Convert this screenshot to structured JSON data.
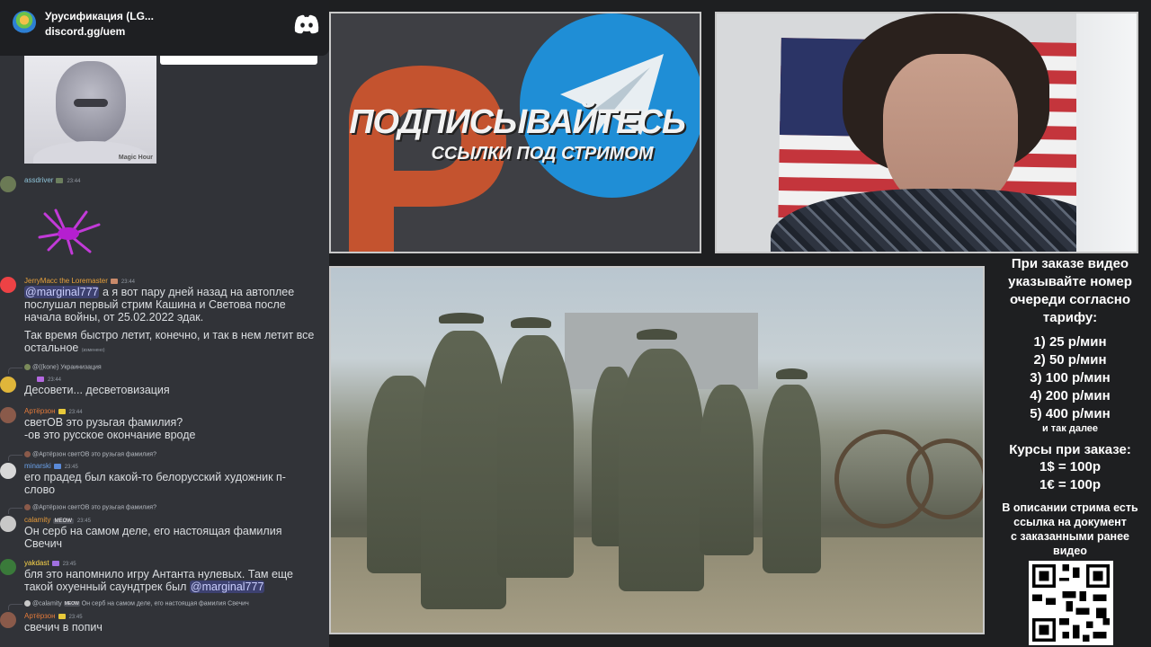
{
  "server": {
    "name": "Урусификация (LG...",
    "invite": "discord.gg/uem"
  },
  "meme": {
    "watermark": "Magic Hour"
  },
  "messages": [
    {
      "user": "assdriver",
      "time": "23:44"
    },
    {
      "user": "JerryMacc the Loremaster",
      "time": "23:44",
      "mention": "@marginal777",
      "line1": " а я вот пару дней назад на автоплее",
      "line2": "послушал первый стрим Кашина и Светова после",
      "line3": "начала войны, от 25.02.2022 эдак.",
      "line4": "Так время быстро летит, конечно, и так в нем летит все",
      "line5": "остальное",
      "edited": "(изменено)"
    },
    {
      "reply_user": "@((kone)",
      "reply_text": "Украинизация",
      "time": "23:44",
      "text": "Десовети... десветовизация"
    },
    {
      "user": "Артёрзон",
      "time": "23:44",
      "line1": "светОВ это рузьгая фамилия?",
      "line2": "-ов это русское окончание вроде"
    },
    {
      "reply_user": "@Артёрзон",
      "reply_text": "светОВ это рузьгая фамилия?",
      "user": "minarski",
      "time": "23:45",
      "line1": "его прадед был какой-то белорусский художник п-",
      "line2": "слово"
    },
    {
      "reply_user": "@Артёрзон",
      "reply_text": "светОВ это рузьгая фамилия?",
      "user": "calamity",
      "tag": "MEOW",
      "time": "23:45",
      "line1": "Он серб на самом деле, его настоящая фамилия",
      "line2": "Свечич"
    },
    {
      "user": "yakdast",
      "time": "23:45",
      "line1": "бля это напомнило игру Антанта нулевых. Там еще",
      "line2": "такой охуенный саундтрек был ",
      "mention": "@marginal777"
    },
    {
      "reply_user": "@calamity",
      "reply_tag": "MEOW",
      "reply_text": "Он серб на самом деле, его настоящая фамилия Свечич",
      "user": "Артёрзон",
      "time": "23:45",
      "text": "свечич в попич"
    }
  ],
  "banner": {
    "title": "ПОДПИСЫВАЙТЕСЬ",
    "subtitle": "ССЫЛКИ ПОД СТРИМОМ"
  },
  "prices": {
    "intro": [
      "При заказе видео",
      "указывайте номер",
      "очереди согласно",
      "тарифу:"
    ],
    "tiers": [
      "1) 25 р/мин",
      "2) 50 р/мин",
      "3) 100 р/мин",
      "4) 200 р/мин",
      "5) 400 р/мин"
    ],
    "etc": "и так далее",
    "rates_title": "Курсы при заказе:",
    "rates": [
      "1$ = 100р",
      "1€ = 100р"
    ],
    "note": [
      "В описании стрима есть",
      "ссылка на документ",
      "с заказанными ранее",
      "видео"
    ]
  },
  "colors": {
    "chat_bg": "#313338",
    "mention": "#c9cdfb",
    "telegram": "#1f8ed6",
    "patreon": "#c4532f"
  }
}
